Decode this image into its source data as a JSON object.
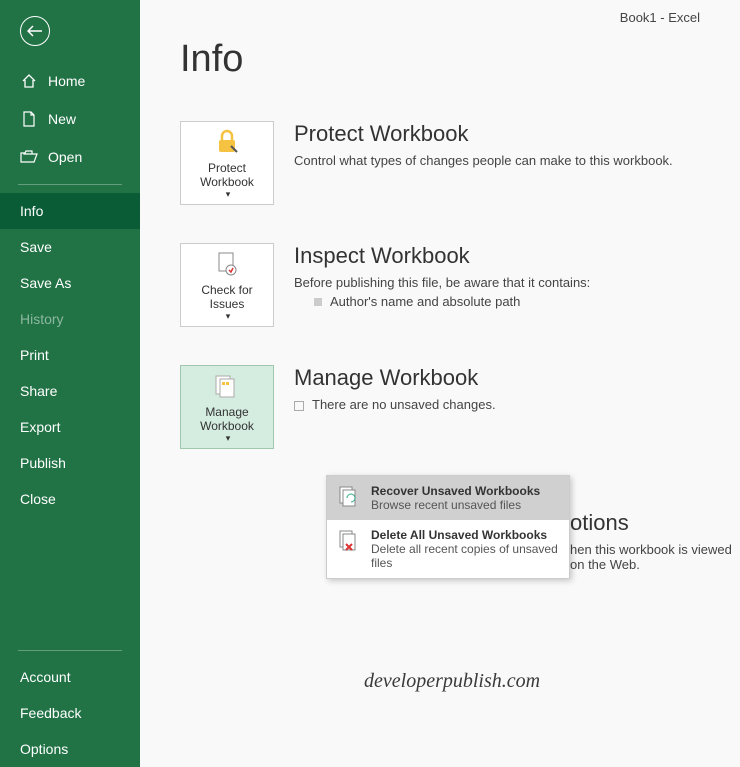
{
  "titlebar": "Book1  -  Excel",
  "page_title": "Info",
  "sidebar": {
    "items": [
      {
        "label": "Home"
      },
      {
        "label": "New"
      },
      {
        "label": "Open"
      },
      {
        "label": "Info"
      },
      {
        "label": "Save"
      },
      {
        "label": "Save As"
      },
      {
        "label": "History"
      },
      {
        "label": "Print"
      },
      {
        "label": "Share"
      },
      {
        "label": "Export"
      },
      {
        "label": "Publish"
      },
      {
        "label": "Close"
      }
    ],
    "footer": [
      {
        "label": "Account"
      },
      {
        "label": "Feedback"
      },
      {
        "label": "Options"
      }
    ]
  },
  "sections": {
    "protect": {
      "btn": "Protect Workbook",
      "title": "Protect Workbook",
      "desc": "Control what types of changes people can make to this workbook."
    },
    "inspect": {
      "btn": "Check for Issues",
      "title": "Inspect Workbook",
      "desc": "Before publishing this file, be aware that it contains:",
      "bullet": "Author's name and absolute path"
    },
    "manage": {
      "btn": "Manage Workbook",
      "title": "Manage Workbook",
      "desc": "There are no unsaved changes."
    },
    "browser": {
      "title_partial": "otions",
      "desc_partial": "hen this workbook is viewed on the Web."
    }
  },
  "menu": {
    "recover": {
      "title": "Recover Unsaved Workbooks",
      "desc": "Browse recent unsaved files"
    },
    "delete": {
      "title": "Delete All Unsaved Workbooks",
      "desc": "Delete all recent copies of unsaved files"
    }
  },
  "watermark": "developerpublish.com"
}
